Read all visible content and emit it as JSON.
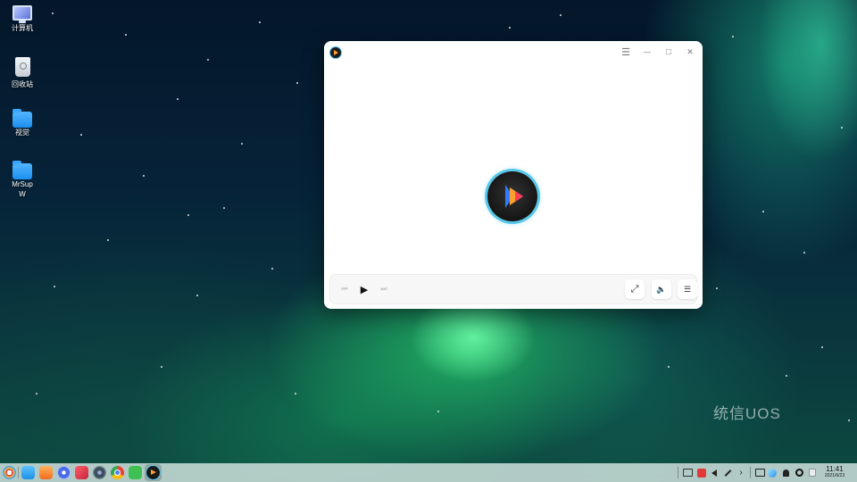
{
  "desktop": {
    "icons": [
      {
        "label": "计算机",
        "icon": "computer-icon"
      },
      {
        "label": "回收站",
        "icon": "trash-icon"
      },
      {
        "label": "视觉",
        "icon": "folder-icon"
      },
      {
        "label": "MrSup W",
        "icon": "folder-icon"
      }
    ],
    "watermark": "统信UOS"
  },
  "window": {
    "app_icon": "movie-player-logo-icon",
    "title_buttons": [
      {
        "name": "menu-button",
        "glyph": "☰"
      },
      {
        "name": "minimize-button",
        "glyph": "—"
      },
      {
        "name": "maximize-button",
        "glyph": "□"
      },
      {
        "name": "close-button",
        "glyph": "✕"
      }
    ],
    "controls": {
      "prev_glyph": "⏮",
      "play_glyph": "▶",
      "next_glyph": "⏭",
      "fullscreen_glyph": "⤢",
      "volume_glyph": "🔈",
      "playlist_glyph": "☰"
    }
  },
  "taskbar": {
    "apps": [
      "launcher-icon",
      "file-manager-icon",
      "app-store-icon",
      "settings-icon",
      "screen-recorder-icon",
      "camera-icon",
      "chrome-icon",
      "wechat-icon",
      "movie-player-icon"
    ],
    "tray": [
      "show-desktop-icon",
      "screenshot-tray-icon",
      "volume-icon",
      "pen-icon",
      "expand-icon",
      "keyboard-icon",
      "network-icon",
      "notification-icon",
      "power-icon",
      "trash-tray-icon"
    ],
    "time": "11:41",
    "date": "2021/6/23"
  },
  "colors": {
    "accent_cyan": "#57c8ea",
    "logo_blue": "#2f7bff",
    "logo_orange": "#ff9f2e",
    "logo_red": "#ff3c5a"
  }
}
